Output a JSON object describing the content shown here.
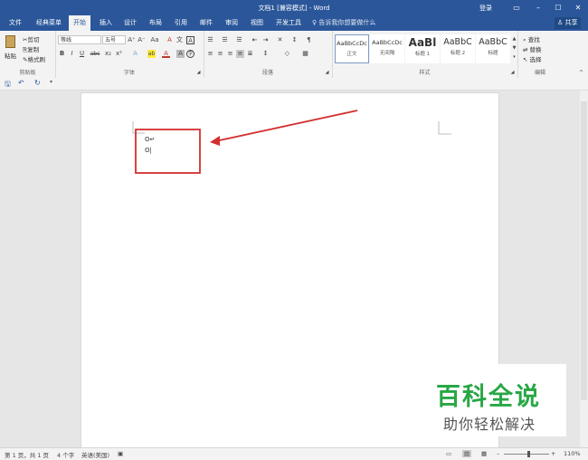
{
  "window": {
    "title": "文档1 [兼容模式] - Word",
    "login": "登录",
    "minimize": "–",
    "restore": "▭",
    "maximize": "☐",
    "close": "✕"
  },
  "tabs": [
    "文件",
    "经典菜单",
    "开始",
    "插入",
    "设计",
    "布局",
    "引用",
    "邮件",
    "审阅",
    "视图",
    "开发工具"
  ],
  "active_tab": "开始",
  "tell_me": "告诉我你想要做什么",
  "share": "共享",
  "clipboard": {
    "paste": "粘贴",
    "cut": "剪切",
    "copy": "复制",
    "format_painter": "格式刷",
    "label": "剪贴板"
  },
  "font": {
    "name": "等线",
    "size": "五号",
    "grow": "A⁺",
    "shrink": "A⁻",
    "case": "Aa",
    "clear": "A",
    "phonetic": "文",
    "border_char": "A",
    "bold": "B",
    "italic": "I",
    "underline": "U",
    "strike": "abc",
    "subscript": "x₂",
    "superscript": "x²",
    "effects": "A",
    "highlight": "ab",
    "color": "A",
    "shading": "A",
    "enclose": "字",
    "label": "字体"
  },
  "paragraph": {
    "label": "段落"
  },
  "styles": {
    "label": "样式",
    "items": [
      {
        "preview": "AaBbCcDc",
        "name": "正文"
      },
      {
        "preview": "AaBbCcDc",
        "name": "无间隔"
      },
      {
        "preview": "AaBl",
        "name": "标题 1"
      },
      {
        "preview": "AaBbC",
        "name": "标题 2"
      },
      {
        "preview": "AaBbC",
        "name": "标题"
      }
    ]
  },
  "editing": {
    "find": "查找",
    "replace": "替换",
    "select": "选择",
    "label": "编辑"
  },
  "quick_access": {
    "save": "🖫",
    "undo": "↶",
    "redo": "↻"
  },
  "document": {
    "line1": "ʘ↵",
    "line2": "ʘ|"
  },
  "status": {
    "page": "第 1 页，共 1 页",
    "words": "4 个字",
    "lang": "英语(美国)",
    "zoom": "110%"
  },
  "watermark": {
    "line1": "百科全说",
    "line2": "助你轻松解决"
  },
  "colors": {
    "brand": "#2b579a",
    "highlight_box": "#d32f2f",
    "watermark_green": "#28a745"
  }
}
